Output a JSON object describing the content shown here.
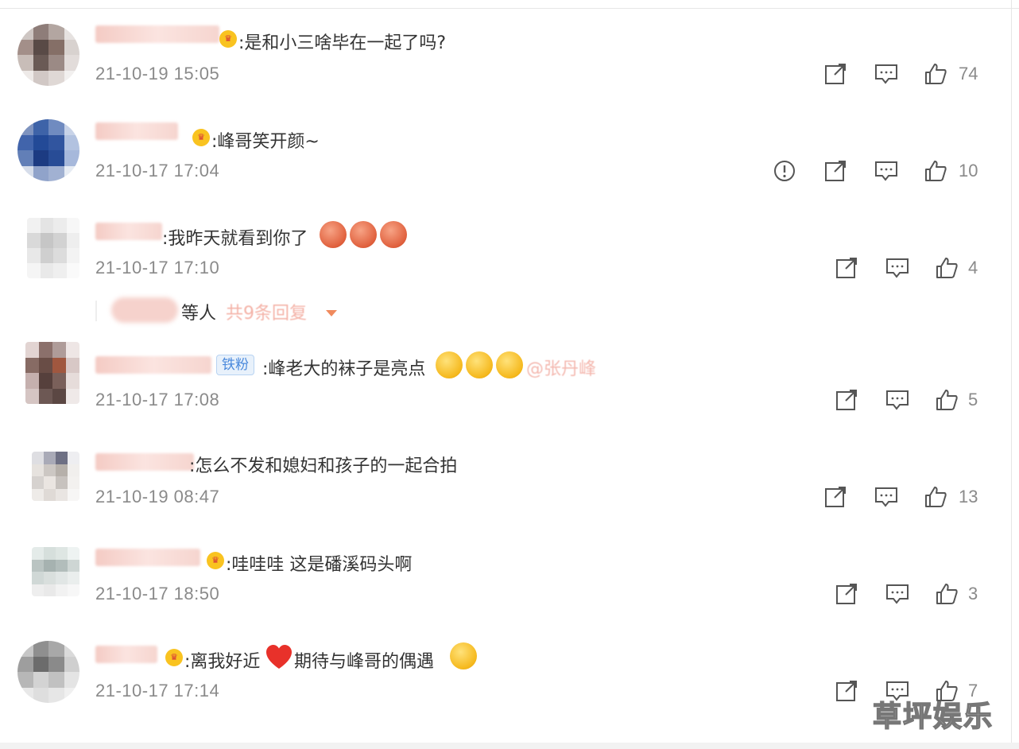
{
  "comments": [
    {
      "text": ":是和小三啥毕在一起了吗?",
      "time": "21-10-19 15:05",
      "likes": "74"
    },
    {
      "text": ":峰哥笑开颜~",
      "time": "21-10-17 17:04",
      "likes": "10"
    },
    {
      "text": ":我昨天就看到你了",
      "time": "21-10-17 17:10",
      "likes": "4"
    },
    {
      "text": ":峰老大的袜子是亮点",
      "time": "21-10-17 17:08",
      "likes": "5",
      "badge": "铁粉",
      "mention": "@张丹峰"
    },
    {
      "text": ":怎么不发和媳妇和孩子的一起合拍",
      "time": "21-10-19 08:47",
      "likes": "13"
    },
    {
      "text": ":哇哇哇 这是磻溪码头啊",
      "time": "21-10-17 18:50",
      "likes": "3"
    },
    {
      "text": ":离我好近",
      "text2": "期待与峰哥的偶遇",
      "time": "21-10-17 17:14",
      "likes": "7"
    }
  ],
  "replies": {
    "label": "等人",
    "count_text": "共9条回复"
  },
  "watermark": "草坪娱乐",
  "colors": {
    "time_gray": "#8a8a8a",
    "vip_gold": "#f9c320",
    "badge_blue": "#4a89dc",
    "reply_link": "#f08a5d"
  },
  "icons": [
    "share-icon",
    "comment-icon",
    "like-icon",
    "report-icon",
    "vip-crown-icon",
    "dropdown-caret-icon"
  ]
}
